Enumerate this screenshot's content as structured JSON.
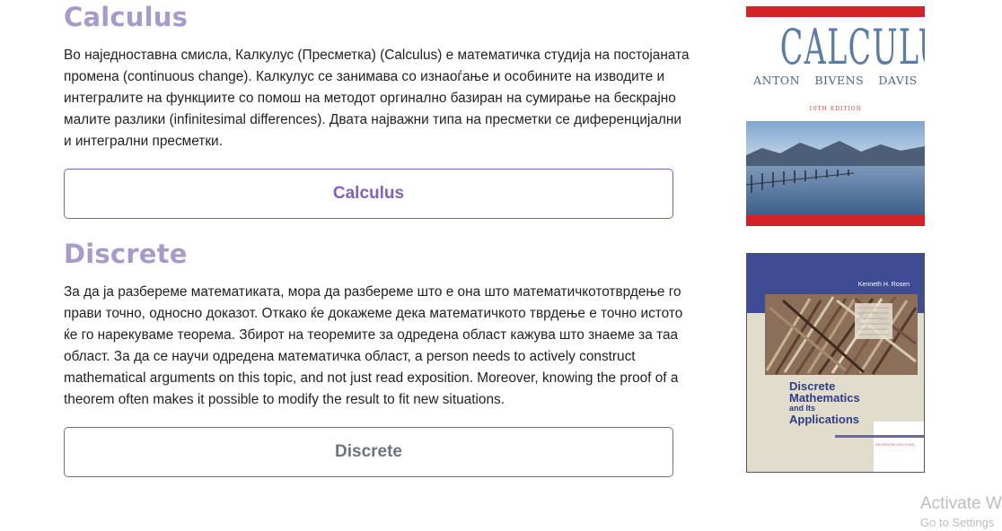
{
  "calculus": {
    "heading": "Calculus",
    "paragraph": "Во наједноставна смисла, Калкулус (Пресметка) (Calculus) е математичка студија на постојаната промена (continuous change). Калкулус се занимава со изнаоѓање и особините на изводите и интегралите на функциите со помош на методот оргинално базиран на сумирање на бескрајно малите разлики (infinitesimal differences). Двата најважни типа на пресметки се диференцијални и интегрални пресметки.",
    "button_label": "Calculus",
    "accent_color": "#8461b4",
    "cover": {
      "title": "CALCULUS",
      "authors": [
        "ANTON",
        "BIVENS",
        "DAVIS"
      ],
      "edition": "10TH EDITION"
    }
  },
  "discrete": {
    "heading": "Discrete",
    "paragraph": "За да ја разбереме математиката, мора да разбереме што е она што математичкототврдење го прави точно, односно доказот. Откако ќе докажеме дека математичкото тврдење е точно истото ќе го нарекуваме теорема. Збирот на теоремите за одредена област кажува што знаеме за таа област. За да се научи одредена математичка област, a person needs to actively construct mathematical arguments on this topic, and not just read exposition. Moreover, knowing the proof of a theorem often makes it possible to modify the result to fit new situations.",
    "button_label": "Discrete",
    "accent_color": "#6c757d",
    "cover": {
      "author": "Kenneth H. Rosen",
      "title_line1": "Discrete",
      "title_line2": "Mathematics",
      "title_line3": "and Its",
      "title_line4": "Applications",
      "edition": "SEVENTH EDITION"
    }
  },
  "watermark": {
    "line1": "Activate W",
    "line2": "Go to Settings"
  }
}
